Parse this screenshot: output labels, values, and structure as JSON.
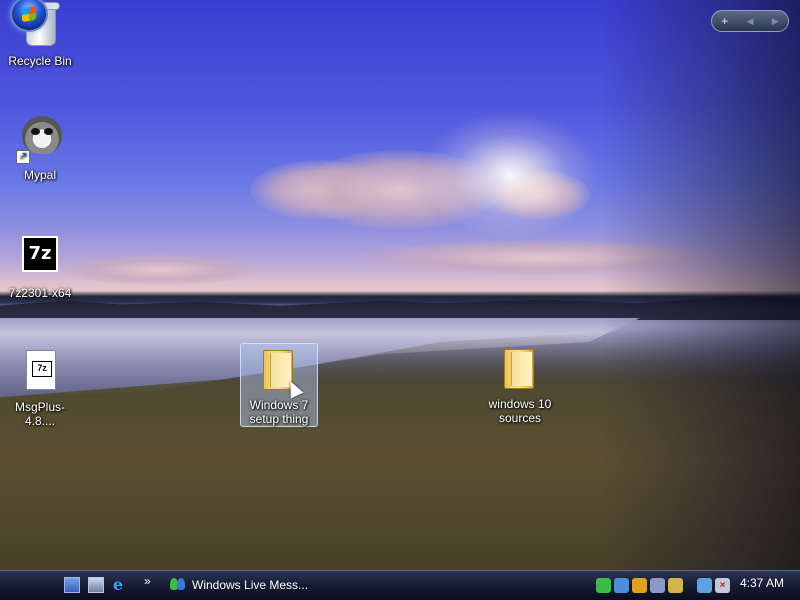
{
  "desktop": {
    "icons": [
      {
        "label": "Recycle Bin",
        "icon": "recycle-bin-icon"
      },
      {
        "label": "Mypal",
        "icon": "raccoon-icon"
      },
      {
        "label": "7z2301-x64",
        "icon": "7zip-installer-icon"
      },
      {
        "label": "MsgPlus-4.8....",
        "icon": "7z-archive-icon"
      },
      {
        "label": "Windows 7 setup thing",
        "icon": "folder-icon",
        "selected": true
      },
      {
        "label": "windows 10 sources",
        "icon": "folder-icon"
      }
    ]
  },
  "gadget_bar": {
    "add_label": "+",
    "prev_label": "◀",
    "next_label": "▶"
  },
  "taskbar": {
    "chevron": "»",
    "quick_launch": [
      "show-desktop-icon",
      "switch-windows-icon",
      "internet-explorer-icon"
    ],
    "ie_glyph": "e",
    "window_button_label": "Windows Live Mess...",
    "tray_icons": [
      "messenger-status-icon",
      "user-icon",
      "security-shield-icon",
      "network-icon",
      "tools-icon",
      "display-icon",
      "volume-muted-icon"
    ],
    "clock": "4:37 AM"
  },
  "colors": {
    "taskbar": "#161b33",
    "selection": "#b4c8f0"
  }
}
